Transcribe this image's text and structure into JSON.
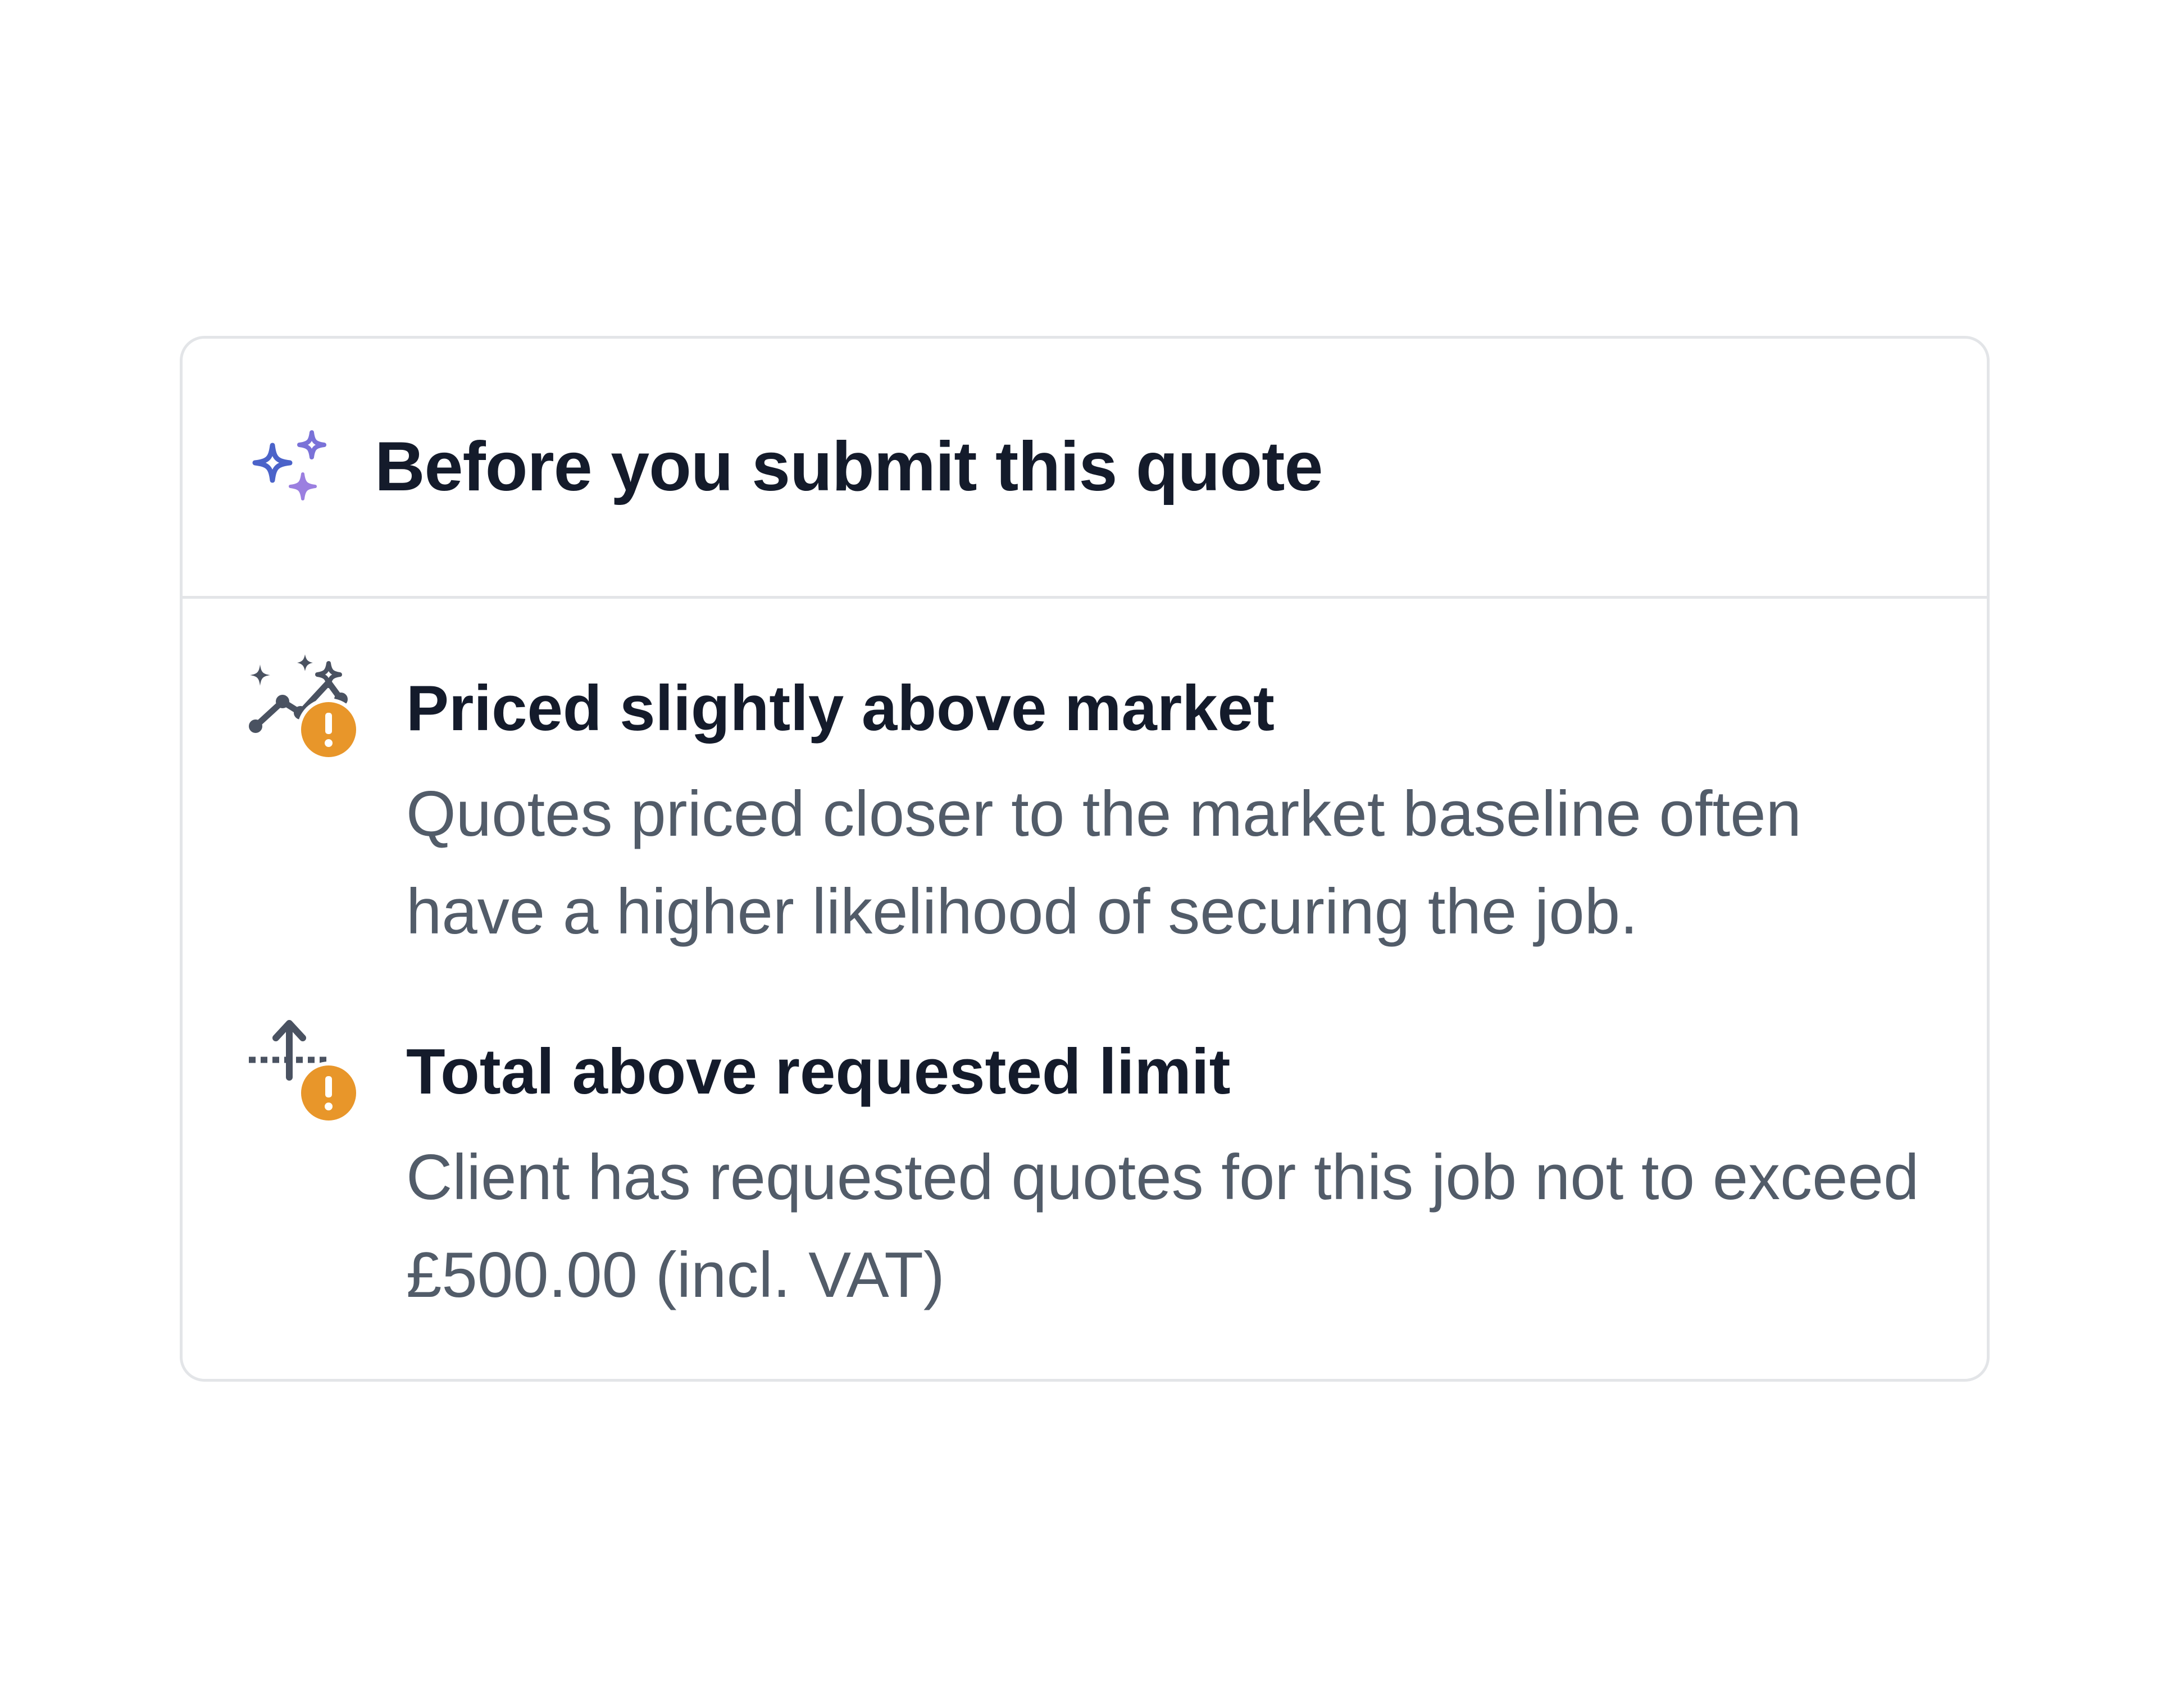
{
  "card": {
    "title": "Before you submit this quote",
    "header_icon": "sparkle-icon"
  },
  "alerts": [
    {
      "icon": "trend-chart-icon",
      "status_icon": "warning-icon",
      "status_glyph": "!",
      "title": "Priced slightly above market",
      "text": "Quotes priced closer to the market baseline often have a higher likelihood of securing the job."
    },
    {
      "icon": "limit-arrow-icon",
      "status_icon": "warning-icon",
      "status_glyph": "!",
      "title": "Total above requested limit",
      "text": "Client has requested quotes for this job not to exceed £500.00 (incl. VAT)"
    }
  ],
  "colors": {
    "warning": "#e8962a",
    "sparkle_blue": "#4b63c9",
    "sparkle_purple": "#9b7fe0",
    "icon_dark": "#4a5261",
    "title": "#141b2b",
    "body_text": "#525c69",
    "border": "#e3e5e8"
  }
}
